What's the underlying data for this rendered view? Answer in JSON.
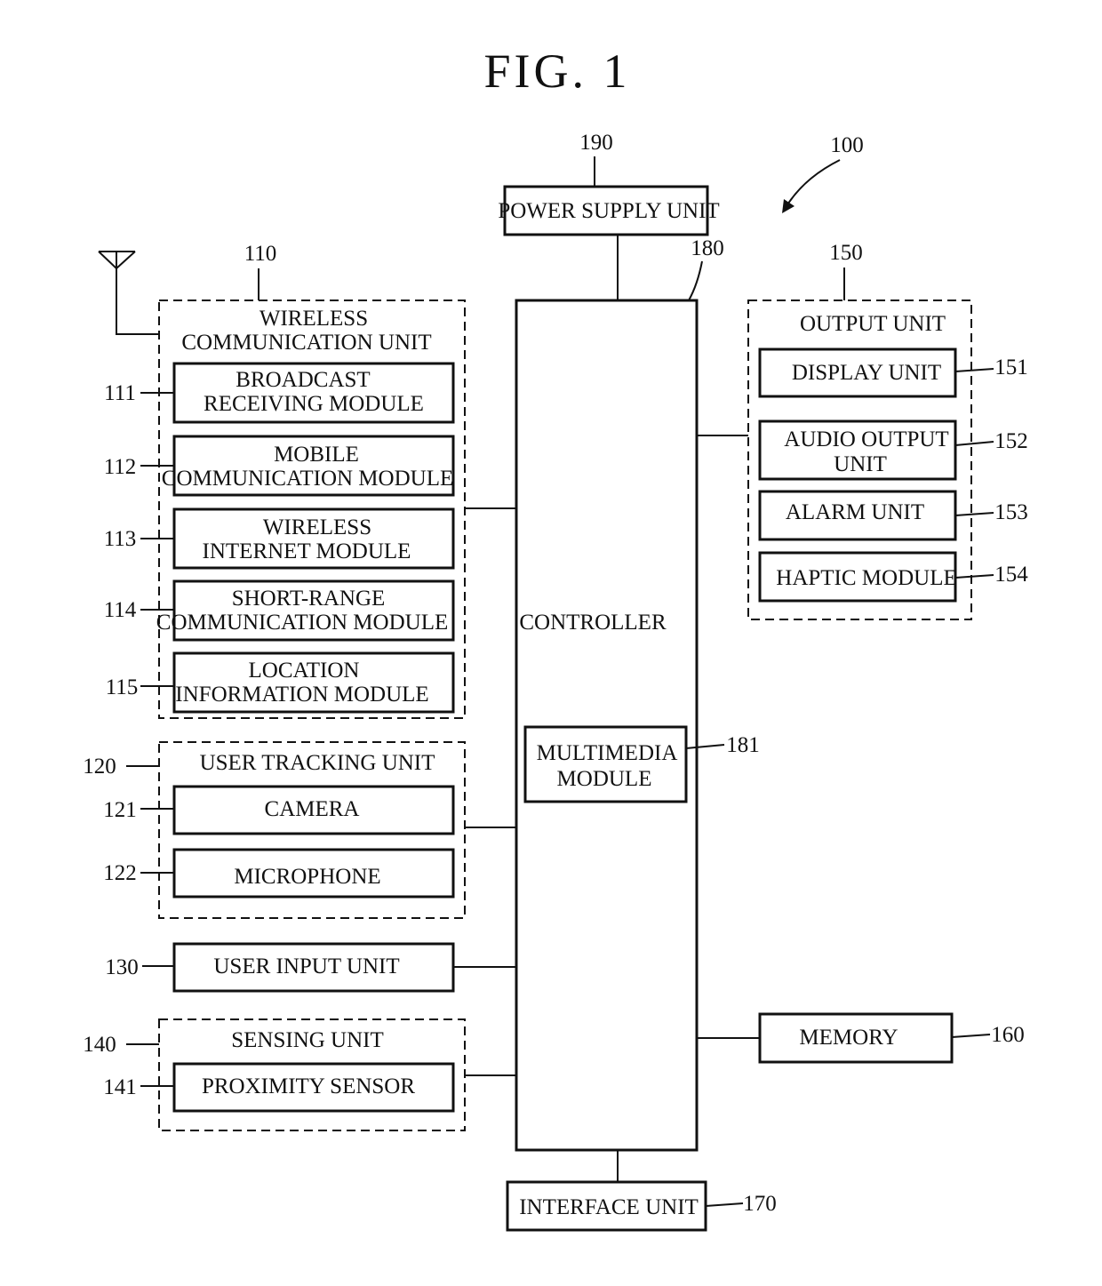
{
  "figure": {
    "title": "FIG. 1",
    "device_ref": "100"
  },
  "power_supply": {
    "label": "POWER SUPPLY UNIT",
    "ref": "190"
  },
  "controller": {
    "label": "CONTROLLER",
    "ref": "180",
    "multimedia": {
      "line1": "MULTIMEDIA",
      "line2": "MODULE",
      "ref": "181"
    }
  },
  "wireless": {
    "ref": "110",
    "line1": "WIRELESS",
    "line2": "COMMUNICATION UNIT",
    "modules": [
      {
        "ref": "111",
        "line1": "BROADCAST",
        "line2": "RECEIVING MODULE"
      },
      {
        "ref": "112",
        "line1": "MOBILE",
        "line2": "COMMUNICATION MODULE"
      },
      {
        "ref": "113",
        "line1": "WIRELESS",
        "line2": "INTERNET MODULE"
      },
      {
        "ref": "114",
        "line1": "SHORT-RANGE",
        "line2": "COMMUNICATION MODULE"
      },
      {
        "ref": "115",
        "line1": "LOCATION",
        "line2": "INFORMATION MODULE"
      }
    ]
  },
  "tracking": {
    "ref": "120",
    "label": "USER TRACKING UNIT",
    "modules": [
      {
        "ref": "121",
        "label": "CAMERA"
      },
      {
        "ref": "122",
        "label": "MICROPHONE"
      }
    ]
  },
  "user_input": {
    "ref": "130",
    "label": "USER INPUT UNIT"
  },
  "sensing": {
    "ref": "140",
    "label": "SENSING UNIT",
    "modules": [
      {
        "ref": "141",
        "label": "PROXIMITY SENSOR"
      }
    ]
  },
  "output": {
    "ref": "150",
    "label": "OUTPUT UNIT",
    "modules": [
      {
        "ref": "151",
        "line1": "DISPLAY UNIT",
        "line2": ""
      },
      {
        "ref": "152",
        "line1": "AUDIO OUTPUT",
        "line2": "UNIT"
      },
      {
        "ref": "153",
        "line1": "ALARM UNIT",
        "line2": ""
      },
      {
        "ref": "154",
        "line1": "HAPTIC MODULE",
        "line2": ""
      }
    ]
  },
  "memory": {
    "ref": "160",
    "label": "MEMORY"
  },
  "interface": {
    "ref": "170",
    "label": "INTERFACE UNIT"
  }
}
